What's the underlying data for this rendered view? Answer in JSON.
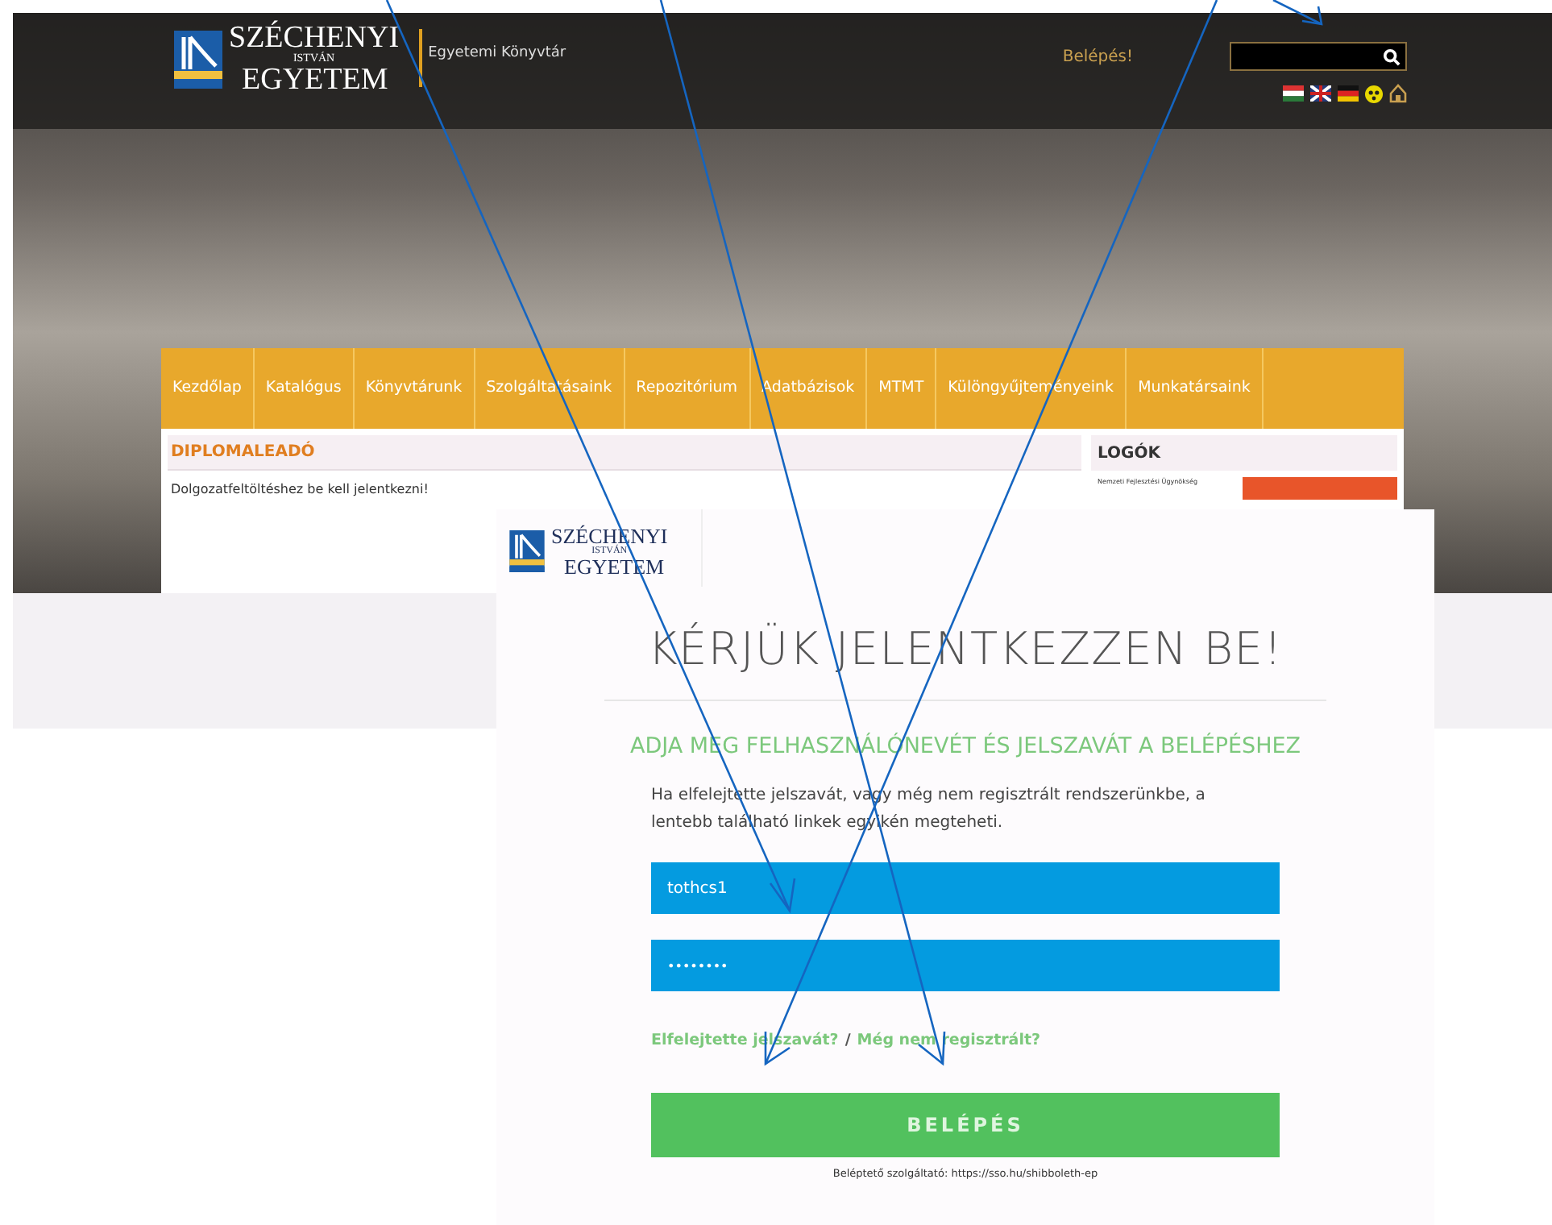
{
  "library_page": {
    "logo": {
      "line_1": "SZÉCHENYI",
      "line_2": "ISTVÁN",
      "line_3": "EGYETEM"
    },
    "site_name": "Egyetemi Könyvtár",
    "login_link": "Belépés!",
    "nav": [
      {
        "label": "Kezdőlap",
        "selected": false
      },
      {
        "label": "Katalógus",
        "selected": false
      },
      {
        "label": "Könyvtárunk",
        "selected": false
      },
      {
        "label": "Szolgáltatásaink",
        "selected": false
      },
      {
        "label": "Repozitórium",
        "selected": false
      },
      {
        "label": "Adatbázisok",
        "selected": false
      },
      {
        "label": "MTMT",
        "selected": false
      },
      {
        "label": "Különgyűjteményeink",
        "selected": false
      },
      {
        "label": "Munkatársaink",
        "selected": false
      }
    ],
    "main": {
      "title": "DIPLOMALEADÓ",
      "text": "Dolgozatfeltöltéshez be kell jelentkezni!"
    },
    "sidebar": {
      "title": "LOGÓK",
      "item": "Nemzeti Fejlesztési Ügynökség"
    }
  },
  "login_panel": {
    "logo": {
      "line_1": "SZÉCHENYI",
      "line_2": "ISTVÁN",
      "line_3": "EGYETEM"
    },
    "title": "KÉRJÜK JELENTKEZZEN BE!",
    "subtitle": "ADJA MEG FELHASZNÁLÓNEVÉT ÉS JELSZAVÁT A BELÉPÉSHEZ",
    "hint": "Ha elfelejtette jelszavát, vagy még nem regisztrált rendszerünkbe, a lentebb található linkek egyikén megteheti.",
    "username": "tothcs1",
    "password": "••••••••",
    "forgot_link": "Elfelejtette jelszavát?",
    "separator": "/",
    "register_link": "Még nem regisztrált?",
    "submit": "BELÉPÉS",
    "footer": "Beléptető szolgáltató: https://sso.hu/shibboleth-ep"
  }
}
